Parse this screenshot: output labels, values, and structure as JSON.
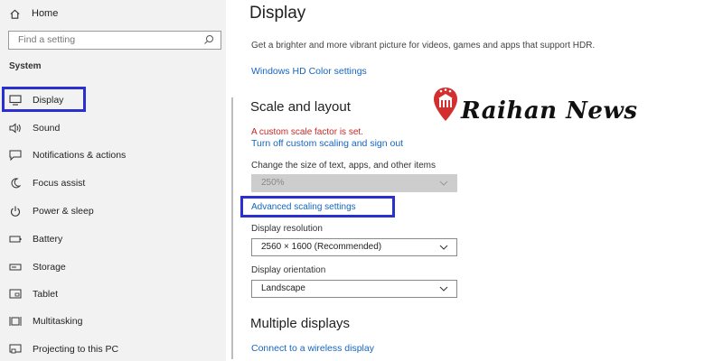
{
  "sidebar": {
    "home_label": "Home",
    "search_placeholder": "Find a setting",
    "section_header": "System",
    "items": [
      {
        "label": "Display",
        "icon": "monitor-icon"
      },
      {
        "label": "Sound",
        "icon": "speaker-icon"
      },
      {
        "label": "Notifications & actions",
        "icon": "notifications-icon"
      },
      {
        "label": "Focus assist",
        "icon": "moon-icon"
      },
      {
        "label": "Power & sleep",
        "icon": "power-icon"
      },
      {
        "label": "Battery",
        "icon": "battery-icon"
      },
      {
        "label": "Storage",
        "icon": "storage-icon"
      },
      {
        "label": "Tablet",
        "icon": "tablet-icon"
      },
      {
        "label": "Multitasking",
        "icon": "multitasking-icon"
      },
      {
        "label": "Projecting to this PC",
        "icon": "projecting-icon"
      }
    ],
    "selected": "Display"
  },
  "main": {
    "title": "Display",
    "description": "Get a brighter and more vibrant picture for videos, games and apps that support HDR.",
    "hdr_link": "Windows HD Color settings",
    "scale_section": {
      "heading": "Scale and layout",
      "warning": "A custom scale factor is set.",
      "turn_off_link": "Turn off custom scaling and sign out",
      "size_label": "Change the size of text, apps, and other items",
      "size_value": "250%",
      "advanced_link": "Advanced scaling settings",
      "resolution_label": "Display resolution",
      "resolution_value": "2560 × 1600 (Recommended)",
      "orientation_label": "Display orientation",
      "orientation_value": "Landscape"
    },
    "multiple_section": {
      "heading": "Multiple displays",
      "wireless_link": "Connect to a wireless display"
    }
  },
  "watermark": {
    "text": "Raihan News",
    "color": "#d32f2f"
  },
  "colors": {
    "accent_link": "#1566c0",
    "highlight_box": "#2a2fd0",
    "warning": "#c62828"
  }
}
